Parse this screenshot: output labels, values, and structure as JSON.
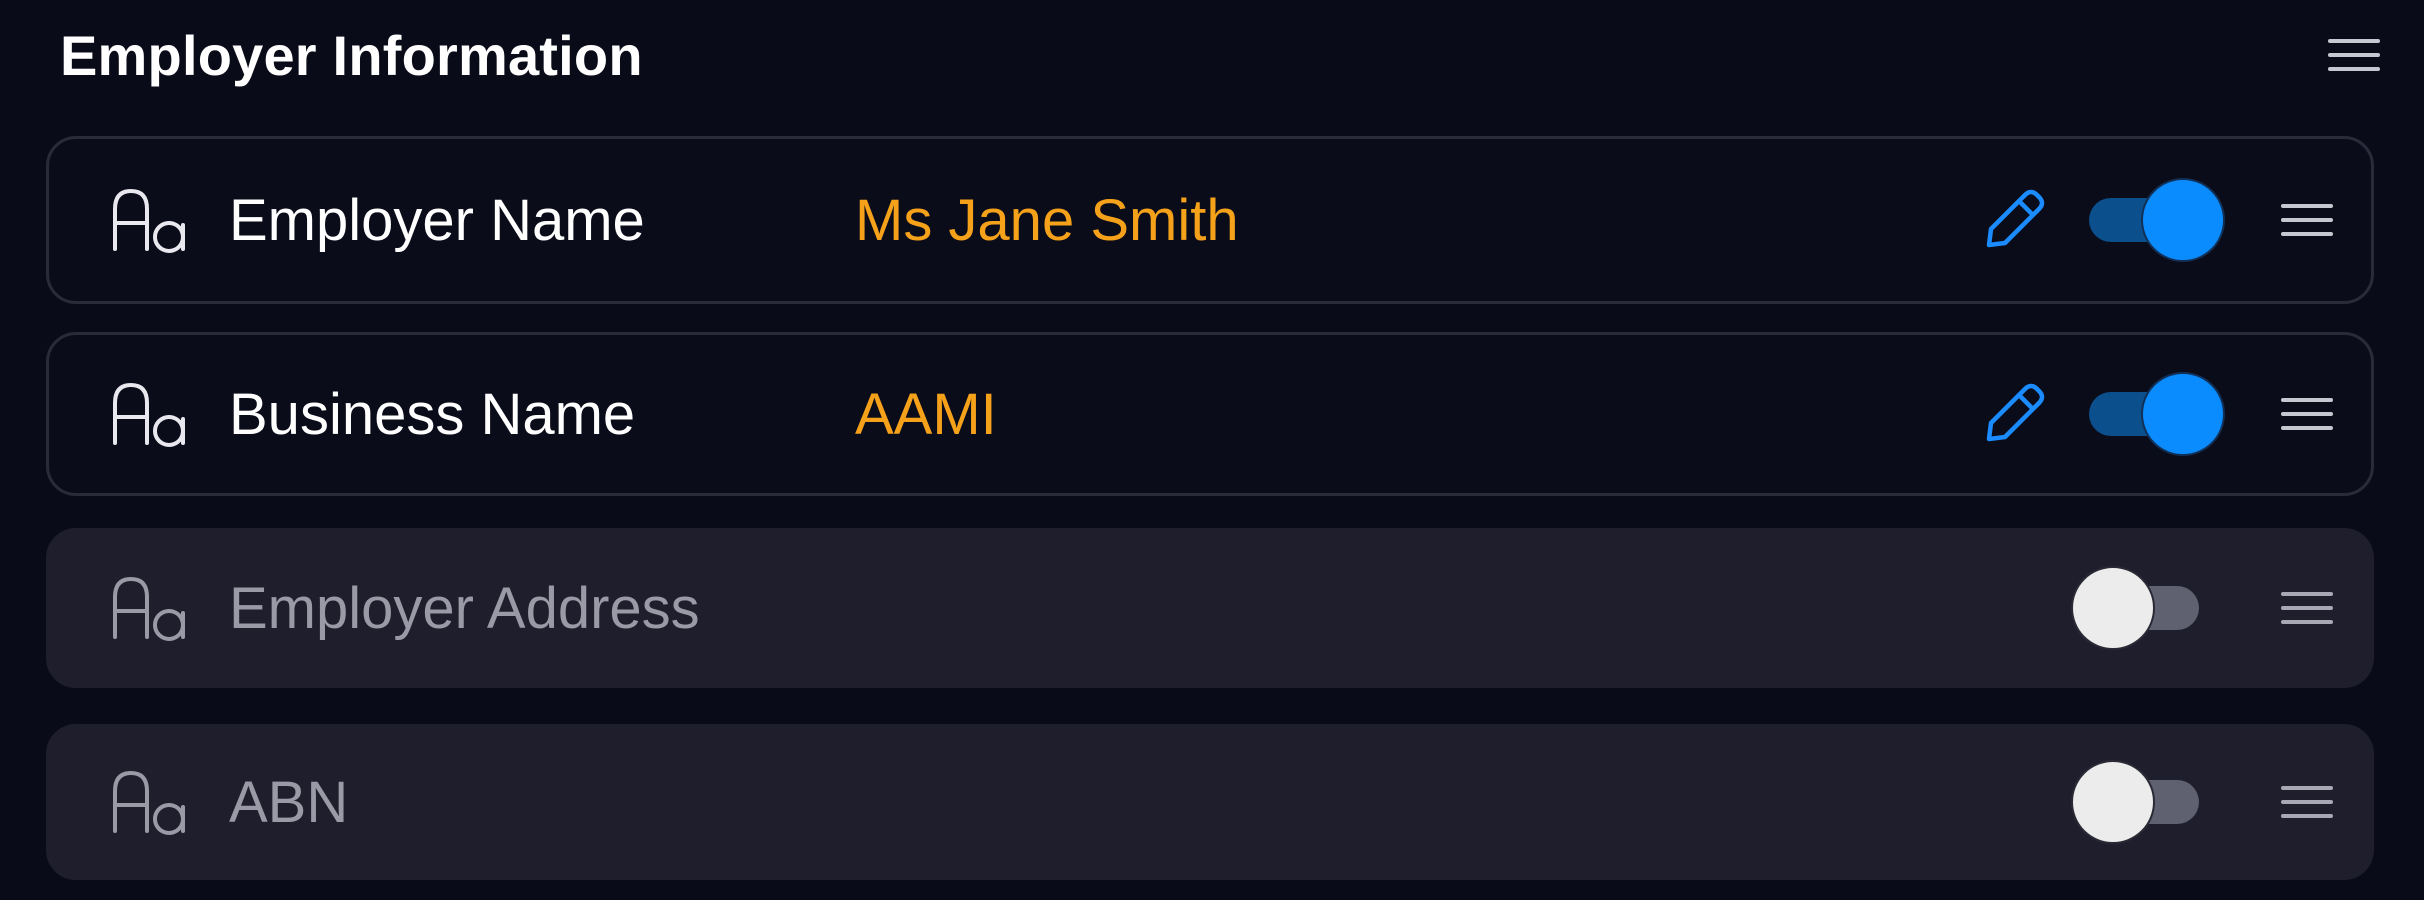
{
  "section": {
    "title": "Employer Information"
  },
  "fields": [
    {
      "label": "Employer Name",
      "value": "Ms Jane Smith",
      "enabled": true,
      "type_icon": "text-type-icon"
    },
    {
      "label": "Business Name",
      "value": "AAMI",
      "enabled": true,
      "type_icon": "text-type-icon"
    },
    {
      "label": "Employer Address",
      "value": "",
      "enabled": false,
      "type_icon": "text-type-icon"
    },
    {
      "label": "ABN",
      "value": "",
      "enabled": false,
      "type_icon": "text-type-icon"
    }
  ],
  "colors": {
    "background": "#0a0b18",
    "value_accent": "#f5a11a",
    "toggle_on": "#0a8cff",
    "edit_icon": "#1a8cff"
  },
  "icons": {
    "type": "text-type-icon",
    "edit": "pencil-icon",
    "drag": "drag-handle-icon"
  }
}
